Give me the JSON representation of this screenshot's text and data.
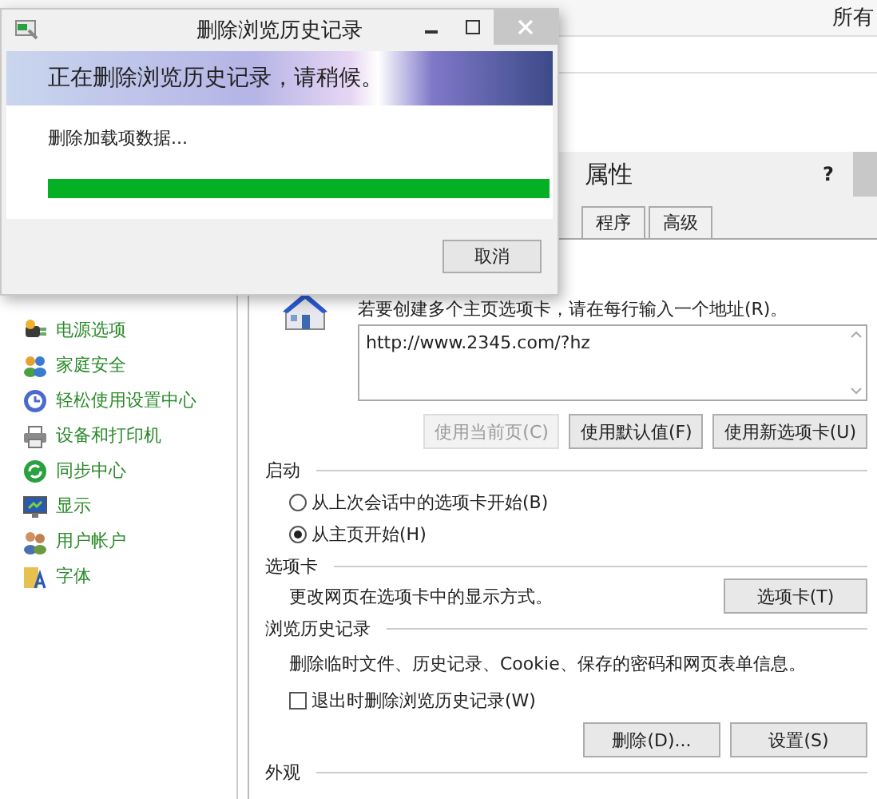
{
  "background_window": {
    "title_fragment": "所有",
    "sidebar_items": [
      {
        "label": "电源选项"
      },
      {
        "label": "家庭安全"
      },
      {
        "label": "轻松使用设置中心"
      },
      {
        "label": "设备和打印机"
      },
      {
        "label": "同步中心"
      },
      {
        "label": "显示"
      },
      {
        "label": "用户帐户"
      },
      {
        "label": "字体"
      }
    ]
  },
  "properties_window": {
    "title": "属性",
    "help": "?",
    "tabs": [
      {
        "label": "程序"
      },
      {
        "label": "高级"
      }
    ],
    "home_page": {
      "hint": "若要创建多个主页选项卡，请在每行输入一个地址(R)。",
      "urls": "http://www.2345.com/?hz",
      "buttons": [
        {
          "label": "使用当前页(C)",
          "disabled": true
        },
        {
          "label": "使用默认值(F)",
          "disabled": false
        },
        {
          "label": "使用新选项卡(U)",
          "disabled": false
        }
      ]
    },
    "startup": {
      "heading": "启动",
      "options": [
        {
          "label": "从上次会话中的选项卡开始(B)",
          "selected": false
        },
        {
          "label": "从主页开始(H)",
          "selected": true
        }
      ]
    },
    "tabs_section": {
      "heading": "选项卡",
      "description": "更改网页在选项卡中的显示方式。",
      "button": "选项卡(T)"
    },
    "history": {
      "heading": "浏览历史记录",
      "description": "删除临时文件、历史记录、Cookie、保存的密码和网页表单信息。",
      "checkbox": {
        "label": "退出时删除浏览历史记录(W)",
        "checked": false
      },
      "buttons": [
        {
          "label": "删除(D)..."
        },
        {
          "label": "设置(S)"
        }
      ]
    },
    "appearance": {
      "heading": "外观"
    }
  },
  "dialog": {
    "title": "删除浏览历史记录",
    "banner": "正在删除浏览历史记录，请稍候。",
    "status": "删除加载项数据...",
    "progress": {
      "level": 1
    },
    "buttons": [
      "取消"
    ]
  }
}
